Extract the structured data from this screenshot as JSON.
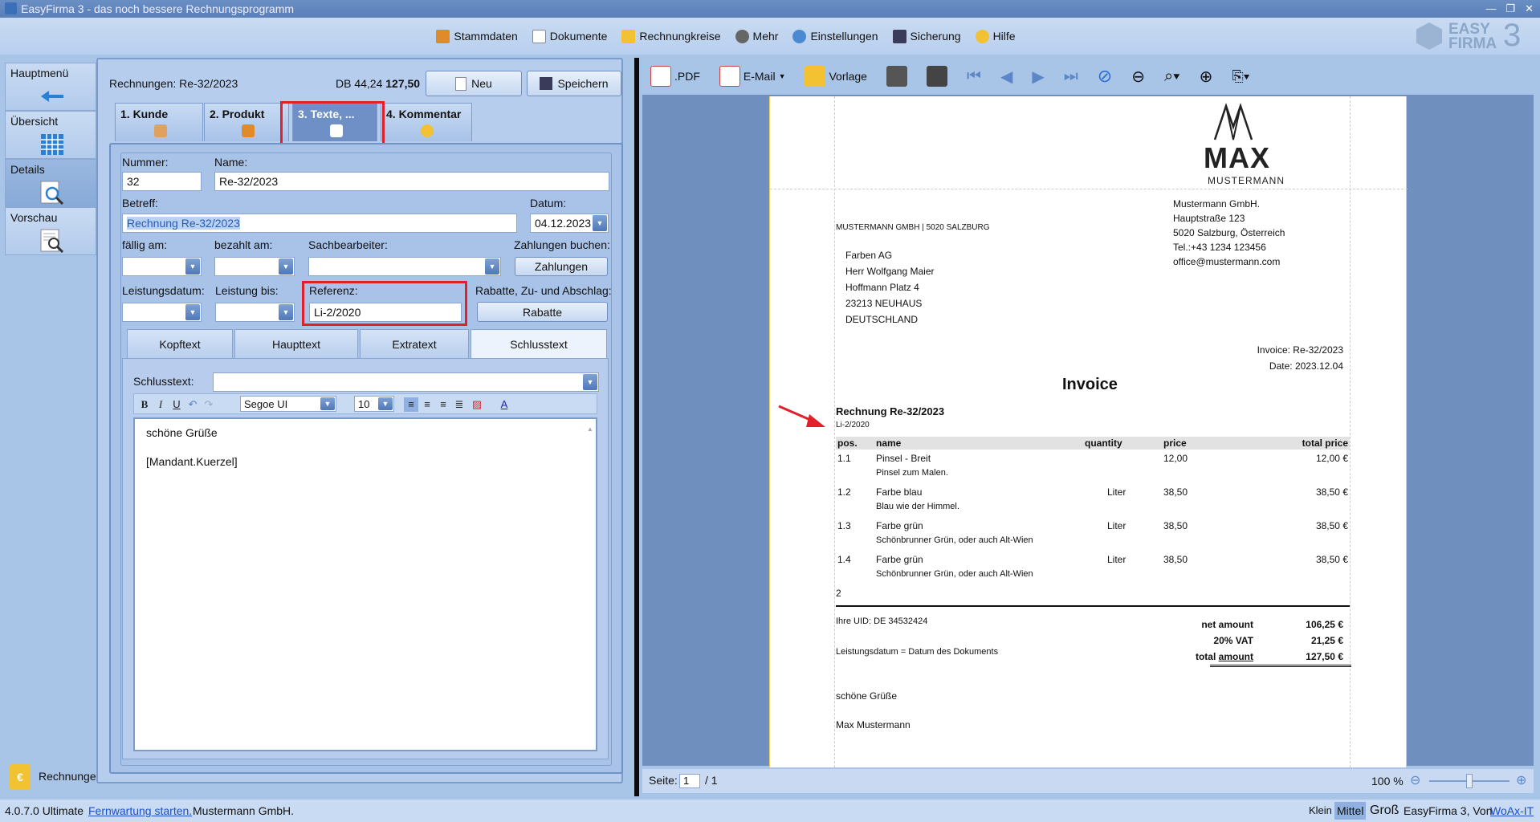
{
  "window": {
    "title": "EasyFirma 3 - das noch bessere Rechnungsprogramm"
  },
  "menu": [
    "Stammdaten",
    "Dokumente",
    "Rechnungkreise",
    "Mehr",
    "Einstellungen",
    "Sicherung",
    "Hilfe"
  ],
  "brand": {
    "line1": "EASY",
    "line2": "FIRMA",
    "num": "3"
  },
  "nav": {
    "items": [
      "Hauptmenü",
      "Übersicht",
      "Details",
      "Vorschau"
    ],
    "bottom_label": "Rechnunge",
    "bottom_icon": "€"
  },
  "form": {
    "heading": "Rechnungen: Re-32/2023",
    "db_label": "DB 44,24",
    "total": "127,50",
    "new_btn": "Neu",
    "save_btn": "Speichern",
    "tabs": [
      "1. Kunde",
      "2. Produkt",
      "3. Texte, ...",
      "4. Kommentar"
    ],
    "labels": {
      "nummer": "Nummer:",
      "name": "Name:",
      "betreff": "Betreff:",
      "datum": "Datum:",
      "faellig": "fällig am:",
      "bezahlt": "bezahlt am:",
      "sachbearbeiter": "Sachbearbeiter:",
      "zahlungen_buchen": "Zahlungen buchen:",
      "leistungsdatum": "Leistungsdatum:",
      "leistung_bis": "Leistung bis:",
      "referenz": "Referenz:",
      "rabatte_label": "Rabatte, Zu- und Abschlag:",
      "schlusstext": "Schlusstext:"
    },
    "values": {
      "nummer": "32",
      "name": "Re-32/2023",
      "betreff": "Rechnung Re-32/2023",
      "datum": "04.12.2023",
      "referenz": "Li-2/2020"
    },
    "zahlungen_btn": "Zahlungen",
    "rabatte_btn": "Rabatte",
    "subtabs": [
      "Kopftext",
      "Haupttext",
      "Extratext",
      "Schlusstext"
    ],
    "editor": {
      "font": "Segoe UI",
      "size": "10",
      "line1": "schöne Grüße",
      "line2": "[Mandant.Kuerzel]"
    }
  },
  "preview": {
    "toolbar": {
      "pdf": ".PDF",
      "email": "E-Mail",
      "vorlage": "Vorlage"
    },
    "page_label": "Seite:",
    "page": "1",
    "page_total": "/ 1",
    "zoom": "100 %",
    "doc": {
      "brand_big": "MAX",
      "brand_small": "MUSTERMANN",
      "sender_line": "MUSTERMANN GMBH | 5020 SALZBURG",
      "company": [
        "Mustermann GmbH.",
        "Hauptstraße 123",
        "5020 Salzburg, Österreich",
        "Tel.:+43 1234 123456",
        "office@mustermann.com"
      ],
      "recipient": [
        "Farben AG",
        "Herr Wolfgang Maier",
        "Hoffmann Platz 4",
        "23213 NEUHAUS",
        "DEUTSCHLAND"
      ],
      "invoice_no": "Invoice: Re-32/2023",
      "date": "Date: 2023.12.04",
      "heading": "Invoice",
      "subject": "Rechnung Re-32/2023",
      "reference": "Li-2/2020",
      "columns": [
        "pos.",
        "name",
        "quantity",
        "price",
        "total price"
      ],
      "rows": [
        {
          "pos": "1.1",
          "name": "Pinsel - Breit",
          "desc": "Pinsel zum Malen.",
          "qty": "",
          "price": "12,00",
          "total": "12,00 €"
        },
        {
          "pos": "1.2",
          "name": "Farbe blau",
          "desc": "Blau wie der Himmel.",
          "qty": "Liter",
          "price": "38,50",
          "total": "38,50 €"
        },
        {
          "pos": "1.3",
          "name": "Farbe grün",
          "desc": "Schönbrunner Grün, oder auch Alt-Wien",
          "qty": "Liter",
          "price": "38,50",
          "total": "38,50 €"
        },
        {
          "pos": "1.4",
          "name": "Farbe grün",
          "desc": "Schönbrunner Grün, oder auch Alt-Wien",
          "qty": "Liter",
          "price": "38,50",
          "total": "38,50 €"
        }
      ],
      "count": "2",
      "uid": "Ihre UID: DE 34532424",
      "leistungsdatum_note": "Leistungsdatum = Datum des Dokuments",
      "net_label": "net amount",
      "net": "106,25 €",
      "vat_label": "20%  VAT",
      "vat": "21,25 €",
      "total_label": "total",
      "total_label2": "amount",
      "total": "127,50 €",
      "closing": "schöne Grüße",
      "signature": "Max Mustermann"
    }
  },
  "zoomsizes": [
    "Klein",
    "Mittel",
    "Groß"
  ],
  "status": {
    "version": "4.0.7.0 Ultimate",
    "link": "Fernwartung starten.",
    "company": "Mustermann GmbH.",
    "right_text": "EasyFirma 3, Von",
    "right_link": "WoAx-IT"
  },
  "colors": {
    "accent": "#e0202a",
    "panel": "#b6cdee"
  }
}
